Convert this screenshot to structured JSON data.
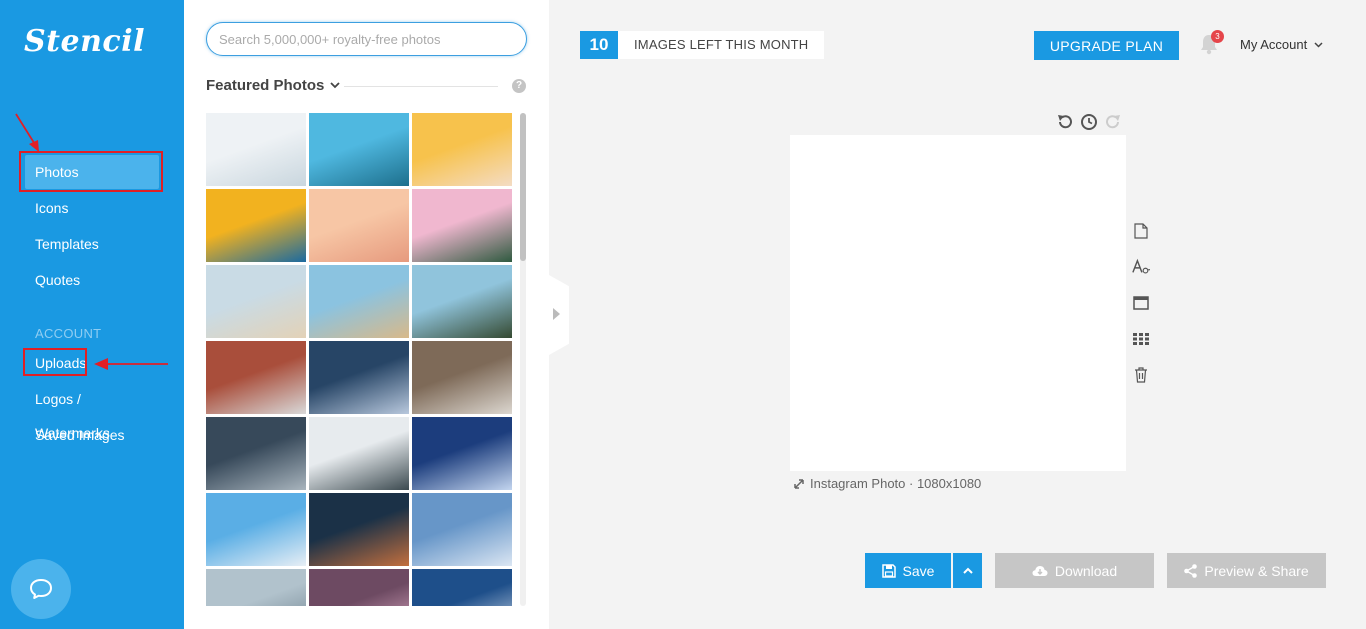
{
  "app": {
    "logo": "Stencil"
  },
  "sidebar": {
    "items": [
      {
        "label": "Photos",
        "active": true
      },
      {
        "label": "Icons"
      },
      {
        "label": "Templates"
      },
      {
        "label": "Quotes"
      }
    ],
    "account_heading": "ACCOUNT",
    "account_items": [
      {
        "label": "Uploads"
      },
      {
        "label": "Logos / Watermarks"
      },
      {
        "label": "Saved Images"
      }
    ],
    "chat_icon": "chat-bubble-icon"
  },
  "photos_panel": {
    "search_placeholder": "Search 5,000,000+ royalty-free photos",
    "section_title": "Featured Photos",
    "help_label": "?",
    "thumbnails": [
      {
        "subject": "ferris wheel",
        "c1": "#eef2f5",
        "c2": "#c9d6de"
      },
      {
        "subject": "palm trees on blue sky",
        "c1": "#4fb8e0",
        "c2": "#1d6f8c"
      },
      {
        "subject": "ice cream cone on yellow",
        "c1": "#f7c24c",
        "c2": "#f4dcc4"
      },
      {
        "subject": "yellow flowers",
        "c1": "#f2b21f",
        "c2": "#1b6aa0"
      },
      {
        "subject": "palm tree at sunset",
        "c1": "#f7c6a5",
        "c2": "#e69a7e"
      },
      {
        "subject": "palm leaf on pink sky",
        "c1": "#f0b7cf",
        "c2": "#2f5a40"
      },
      {
        "subject": "beach with palm trees",
        "c1": "#c9dbe5",
        "c2": "#e3d2b7"
      },
      {
        "subject": "sunglasses on sand",
        "c1": "#8bc3e0",
        "c2": "#d8b98a"
      },
      {
        "subject": "palm trees from below",
        "c1": "#90c4dc",
        "c2": "#354a32"
      },
      {
        "subject": "brooklyn bridge street",
        "c1": "#a94e3b",
        "c2": "#d9d9d9"
      },
      {
        "subject": "snowy mountains",
        "c1": "#274566",
        "c2": "#b8c8dd"
      },
      {
        "subject": "rocky snowy peaks",
        "c1": "#7e6a58",
        "c2": "#dcd7d0"
      },
      {
        "subject": "snowy cabin",
        "c1": "#37495a",
        "c2": "#a8b4bd"
      },
      {
        "subject": "foggy forest in snow",
        "c1": "#e7ebee",
        "c2": "#3c4a50"
      },
      {
        "subject": "frozen bubble",
        "c1": "#1c3d7d",
        "c2": "#c3d5ef"
      },
      {
        "subject": "snowy pine trees",
        "c1": "#5aaee5",
        "c2": "#e7eef5"
      },
      {
        "subject": "snowy city street at night",
        "c1": "#1b3147",
        "c2": "#c36f3e"
      },
      {
        "subject": "snow dunes",
        "c1": "#6796c8",
        "c2": "#dbe6f3"
      },
      {
        "subject": "frost crystals",
        "c1": "#b1c2cc",
        "c2": "#6a7d8a"
      },
      {
        "subject": "pink blossoms",
        "c1": "#6d4a62",
        "c2": "#e8b4cd"
      },
      {
        "subject": "snowy slopes",
        "c1": "#1e4f8a",
        "c2": "#e1e9f3"
      }
    ]
  },
  "topbar": {
    "images_left": "10",
    "images_left_label": "IMAGES LEFT THIS MONTH",
    "upgrade_label": "UPGRADE PLAN",
    "notification_count": "3",
    "account_label": "My Account"
  },
  "canvas": {
    "info_label": "Instagram Photo · 1080x1080",
    "tools": [
      "document-icon",
      "text-style-icon",
      "browser-window-icon",
      "grid-icon",
      "trash-icon"
    ]
  },
  "actions": {
    "save_label": "Save",
    "download_label": "Download",
    "preview_label": "Preview & Share"
  },
  "colors": {
    "brand": "#1a99e2",
    "annotation": "#e11f26",
    "disabled": "#c6c6c6"
  }
}
